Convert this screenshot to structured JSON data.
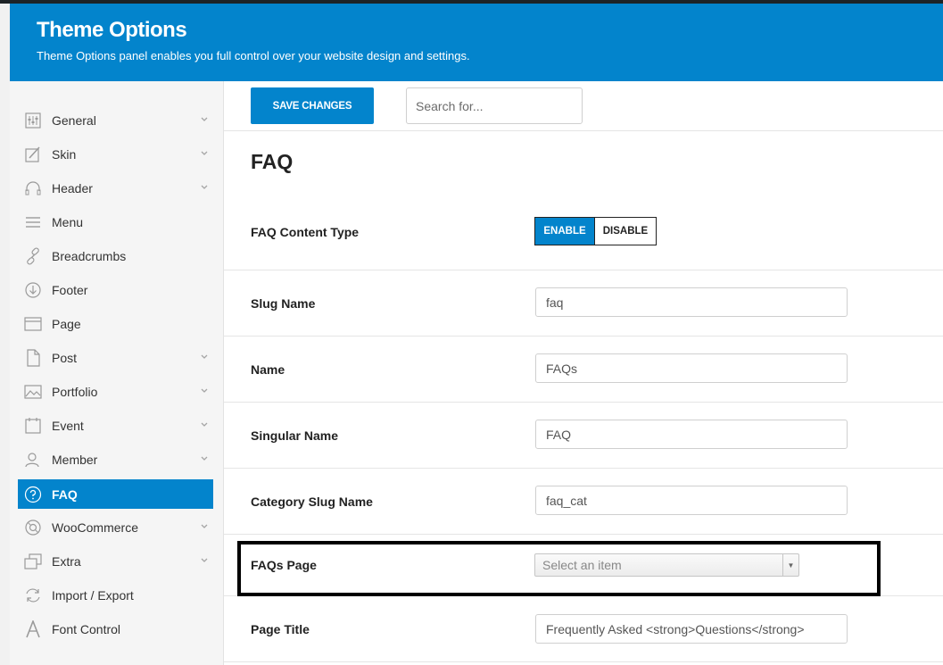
{
  "header": {
    "title": "Theme Options",
    "subtitle": "Theme Options panel enables you full control over your website design and settings."
  },
  "toolbar": {
    "save_label": "SAVE CHANGES",
    "search_placeholder": "Search for..."
  },
  "sidebar": {
    "active_color": "#0384cc",
    "items": [
      {
        "label": "General",
        "icon": "sliders-icon",
        "has_submenu": true
      },
      {
        "label": "Skin",
        "icon": "paint-icon",
        "has_submenu": true
      },
      {
        "label": "Header",
        "icon": "headphones-icon",
        "has_submenu": true
      },
      {
        "label": "Menu",
        "icon": "menu-icon",
        "has_submenu": false
      },
      {
        "label": "Breadcrumbs",
        "icon": "link-icon",
        "has_submenu": false
      },
      {
        "label": "Footer",
        "icon": "arrow-down-circle-icon",
        "has_submenu": false
      },
      {
        "label": "Page",
        "icon": "browser-icon",
        "has_submenu": false
      },
      {
        "label": "Post",
        "icon": "document-icon",
        "has_submenu": true
      },
      {
        "label": "Portfolio",
        "icon": "image-icon",
        "has_submenu": true
      },
      {
        "label": "Event",
        "icon": "calendar-icon",
        "has_submenu": true
      },
      {
        "label": "Member",
        "icon": "users-icon",
        "has_submenu": true
      },
      {
        "label": "FAQ",
        "icon": "question-circle-icon",
        "has_submenu": false,
        "active": true
      },
      {
        "label": "WooCommerce",
        "icon": "support-icon",
        "has_submenu": true
      },
      {
        "label": "Extra",
        "icon": "layers-icon",
        "has_submenu": true
      },
      {
        "label": "Import / Export",
        "icon": "refresh-icon",
        "has_submenu": false
      },
      {
        "label": "Font Control",
        "icon": "font-icon",
        "has_submenu": false
      }
    ]
  },
  "main": {
    "section_title": "FAQ",
    "fields": {
      "content_type": {
        "label": "FAQ Content Type",
        "enable": "ENABLE",
        "disable": "DISABLE",
        "value": "ENABLE"
      },
      "slug_name": {
        "label": "Slug Name",
        "value": "faq"
      },
      "name": {
        "label": "Name",
        "value": "FAQs"
      },
      "singular_name": {
        "label": "Singular Name",
        "value": "FAQ"
      },
      "category_slug": {
        "label": "Category Slug Name",
        "value": "faq_cat"
      },
      "faqs_page": {
        "label": "FAQs Page",
        "placeholder": "Select an item"
      },
      "page_title": {
        "label": "Page Title",
        "value": "Frequently Asked <strong>Questions</strong>"
      }
    }
  }
}
